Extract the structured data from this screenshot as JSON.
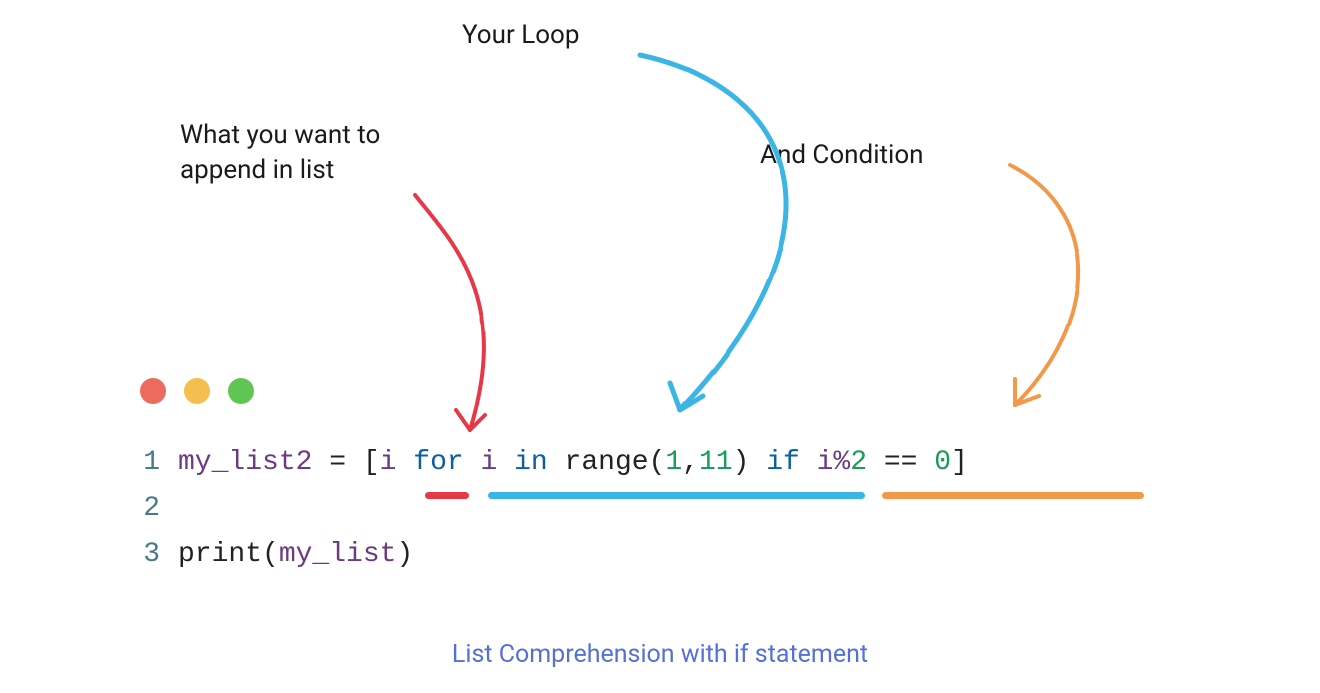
{
  "labels": {
    "loop": "Your Loop",
    "append_line1": "What you want to",
    "append_line2": "append in list",
    "condition": "And Condition"
  },
  "code": {
    "lines": {
      "no1": "1",
      "no2": "2",
      "no3": "3"
    },
    "line1": {
      "var": "my_list2",
      "assign": " = ",
      "lbrack": "[",
      "i1": "i ",
      "for": "for",
      "i2": " i ",
      "in": "in",
      "sp1": " ",
      "range": "range",
      "lparen": "(",
      "num1": "1",
      "comma": ",",
      "num11": "11",
      "rparen": ")",
      "sp2": " ",
      "if": "if",
      "sp3": " i%",
      "num2": "2",
      "eq": " == ",
      "num0": "0",
      "rbrack": "]"
    },
    "line3": {
      "print": "print",
      "lparen": "(",
      "arg": "my_list",
      "rparen": ")"
    }
  },
  "caption": "List Comprehension with if statement",
  "colors": {
    "red": "#e63946",
    "blue": "#3ab5e6",
    "orange": "#f2994a",
    "caption": "#5570d6"
  }
}
